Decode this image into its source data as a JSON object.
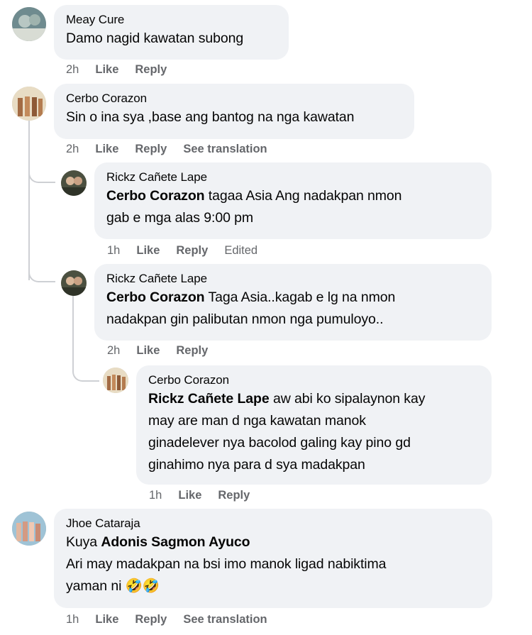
{
  "comments": [
    {
      "author": "Meay Cure",
      "text": "Damo nagid kawatan subong",
      "time": "2h",
      "actions": [
        "Like",
        "Reply"
      ]
    },
    {
      "author": "Cerbo Corazon",
      "text": "Sin o ina sya ,base ang bantog na nga kawatan",
      "time": "2h",
      "actions": [
        "Like",
        "Reply",
        "See translation"
      ]
    },
    {
      "author": "Rickz Cañete Lape",
      "mention": "Cerbo Corazon",
      "line1": "tagaa Asia Ang nadakpan nmon",
      "line2": "gab e mga alas 9:00 pm",
      "time": "1h",
      "actions": [
        "Like",
        "Reply"
      ],
      "edited": "Edited"
    },
    {
      "author": "Rickz Cañete Lape",
      "mention": "Cerbo Corazon",
      "line1": "Taga Asia..kagab e lg na nmon",
      "line2": "nadakpan gin palibutan nmon nga pumuloyo..",
      "time": "2h",
      "actions": [
        "Like",
        "Reply"
      ]
    },
    {
      "author": "Cerbo Corazon",
      "mention": "Rickz Cañete Lape",
      "line1": "aw abi ko sipalaynon kay",
      "line2": "may are man d nga kawatan manok",
      "line3": "ginadelever nya bacolod galing kay pino gd",
      "line4": "ginahimo nya para d sya madakpan",
      "time": "1h",
      "actions": [
        "Like",
        "Reply"
      ]
    },
    {
      "author": "Jhoe Cataraja",
      "prefix": "Kuya",
      "mention": "Adonis Sagmon Ayuco",
      "line2": "Ari may madakpan na bsi imo manok ligad nabiktima",
      "line3": "yaman ni 🤣🤣",
      "time": "1h",
      "actions": [
        "Like",
        "Reply",
        "See translation"
      ]
    }
  ]
}
